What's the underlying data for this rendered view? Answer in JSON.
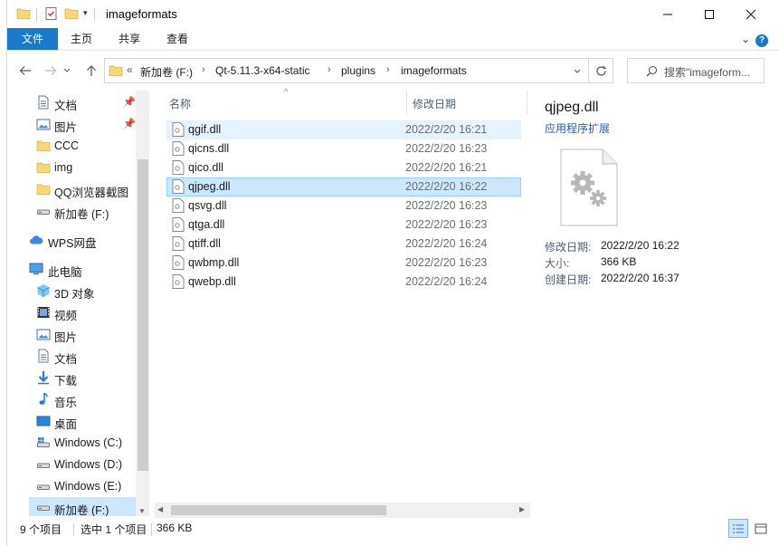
{
  "window": {
    "title": "imageformats"
  },
  "ribbon": {
    "tabs": [
      "文件",
      "主页",
      "共享",
      "查看"
    ]
  },
  "address": {
    "overflow": "«",
    "crumbs": [
      "新加卷 (F:)",
      "Qt-5.11.3-x64-static",
      "plugins",
      "imageformats"
    ]
  },
  "search": {
    "placeholder": "搜索\"imageform..."
  },
  "sidebar": {
    "items": [
      {
        "label": "文档",
        "icon": "document-icon",
        "pinned": true
      },
      {
        "label": "图片",
        "icon": "picture-icon",
        "pinned": true
      },
      {
        "label": "CCC",
        "icon": "folder-icon"
      },
      {
        "label": "img",
        "icon": "folder-icon"
      },
      {
        "label": "QQ浏览器截图",
        "icon": "folder-icon"
      },
      {
        "label": "新加卷 (F:)",
        "icon": "drive-icon"
      },
      {
        "label": "WPS网盘",
        "icon": "cloud-icon"
      },
      {
        "label": "此电脑",
        "icon": "computer-icon"
      },
      {
        "label": "3D 对象",
        "icon": "cube-icon"
      },
      {
        "label": "视频",
        "icon": "video-icon"
      },
      {
        "label": "图片",
        "icon": "picture-icon"
      },
      {
        "label": "文档",
        "icon": "document-icon"
      },
      {
        "label": "下载",
        "icon": "download-icon"
      },
      {
        "label": "音乐",
        "icon": "music-icon"
      },
      {
        "label": "桌面",
        "icon": "desktop-icon"
      },
      {
        "label": "Windows (C:)",
        "icon": "system-drive-icon"
      },
      {
        "label": "Windows (D:)",
        "icon": "drive-icon"
      },
      {
        "label": "Windows (E:)",
        "icon": "drive-icon"
      },
      {
        "label": "新加卷 (F:)",
        "icon": "drive-icon",
        "selected": true
      }
    ]
  },
  "list": {
    "columns": {
      "name": "名称",
      "modified": "修改日期"
    },
    "files": [
      {
        "name": "qgif.dll",
        "date": "2022/2/20 16:21"
      },
      {
        "name": "qicns.dll",
        "date": "2022/2/20 16:23"
      },
      {
        "name": "qico.dll",
        "date": "2022/2/20 16:21"
      },
      {
        "name": "qjpeg.dll",
        "date": "2022/2/20 16:22"
      },
      {
        "name": "qsvg.dll",
        "date": "2022/2/20 16:23"
      },
      {
        "name": "qtga.dll",
        "date": "2022/2/20 16:23"
      },
      {
        "name": "qtiff.dll",
        "date": "2022/2/20 16:24"
      },
      {
        "name": "qwbmp.dll",
        "date": "2022/2/20 16:23"
      },
      {
        "name": "qwebp.dll",
        "date": "2022/2/20 16:24"
      }
    ]
  },
  "preview": {
    "name": "qjpeg.dll",
    "type": "应用程序扩展",
    "props": [
      {
        "label": "修改日期:",
        "value": "2022/2/20 16:22"
      },
      {
        "label": "大小:",
        "value": "366 KB"
      },
      {
        "label": "创建日期:",
        "value": "2022/2/20 16:37"
      }
    ]
  },
  "status": {
    "count": "9 个项目",
    "selection": "选中 1 个项目",
    "size": "366 KB"
  },
  "colors": {
    "accent": "#1979ca",
    "selection": "#cce8ff",
    "hover": "#e5f3ff",
    "folder": "#f8d775"
  }
}
